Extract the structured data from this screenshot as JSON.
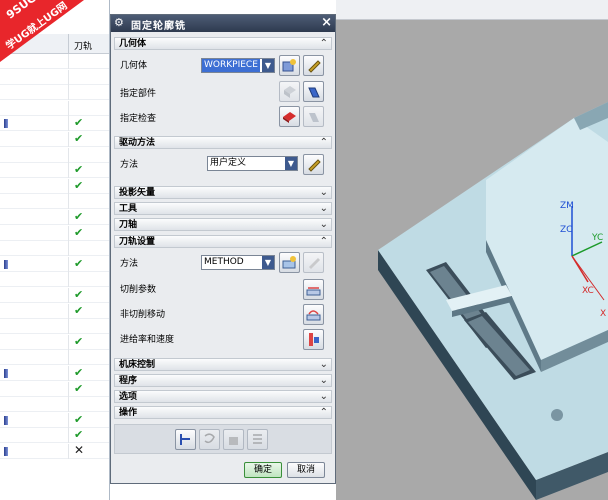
{
  "watermark": {
    "line1": "9SUG",
    "line2": "学UG就上UG网"
  },
  "navigator": {
    "col_toolpath": "刀轨",
    "rows": [
      {
        "blip": false,
        "status": ""
      },
      {
        "blip": false,
        "status": ""
      },
      {
        "blip": false,
        "status": ""
      },
      {
        "blip": false,
        "status": ""
      },
      {
        "blip": true,
        "status": "✔"
      },
      {
        "blip": false,
        "status": "✔"
      },
      {
        "blip": false,
        "status": ""
      },
      {
        "blip": false,
        "status": "✔"
      },
      {
        "blip": false,
        "status": "✔"
      },
      {
        "blip": false,
        "status": ""
      },
      {
        "blip": false,
        "status": "✔"
      },
      {
        "blip": false,
        "status": "✔"
      },
      {
        "blip": false,
        "status": ""
      },
      {
        "blip": true,
        "status": "✔"
      },
      {
        "blip": false,
        "status": ""
      },
      {
        "blip": false,
        "status": "✔"
      },
      {
        "blip": false,
        "status": "✔"
      },
      {
        "blip": false,
        "status": ""
      },
      {
        "blip": false,
        "status": "✔"
      },
      {
        "blip": false,
        "status": ""
      },
      {
        "blip": true,
        "status": "✔"
      },
      {
        "blip": false,
        "status": "✔"
      },
      {
        "blip": false,
        "status": ""
      },
      {
        "blip": true,
        "status": "✔"
      },
      {
        "blip": false,
        "status": "✔"
      },
      {
        "blip": true,
        "status": "✕"
      }
    ]
  },
  "dialog": {
    "title": "固定轮廓铣",
    "close": "×",
    "sections": {
      "geometry": "几何体",
      "drive_method": "驱动方法",
      "projection_vector": "投影矢量",
      "tool": "工具",
      "tool_axis": "刀轴",
      "path_settings": "刀轨设置",
      "machine_control": "机床控制",
      "program": "程序",
      "options": "选项",
      "operations": "操作"
    },
    "geometry": {
      "geometry_label": "几何体",
      "geometry_value": "WORKPIECE",
      "part_label": "指定部件",
      "check_label": "指定检查"
    },
    "drive": {
      "method_label": "方法",
      "method_value": "用户定义"
    },
    "path": {
      "method_label": "方法",
      "method_value": "METHOD",
      "cut_params": "切削参数",
      "non_cut_moves": "非切削移动",
      "feeds_speeds": "进给率和速度"
    },
    "ok": "确定",
    "cancel": "取消"
  },
  "viewport": {
    "axes": {
      "zm": "ZM",
      "zc": "ZC",
      "yc": "YC",
      "xc": "XC",
      "x": "X"
    }
  }
}
